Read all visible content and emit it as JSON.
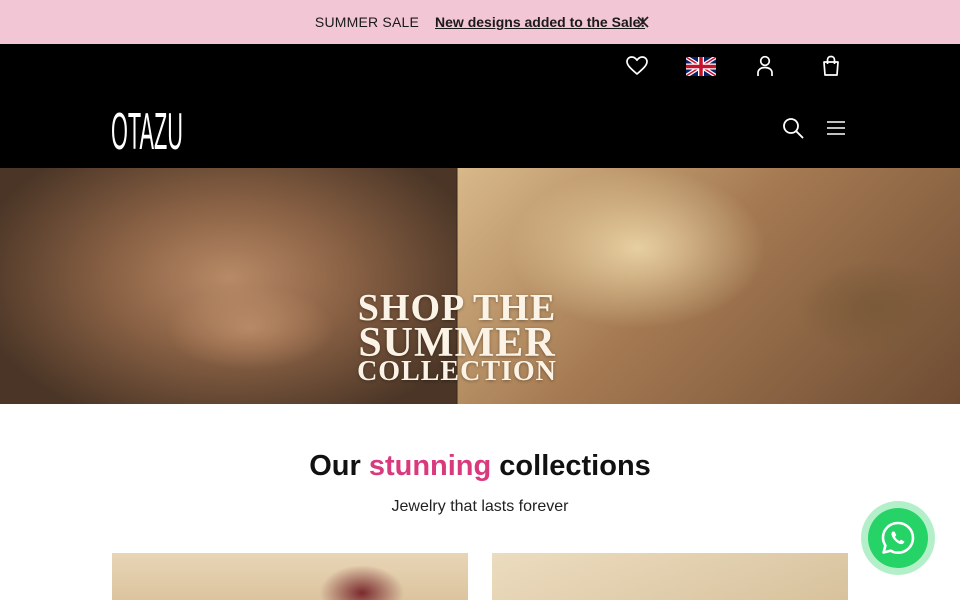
{
  "announcement": {
    "sale_text": "SUMMER SALE",
    "link_text": "New designs added to the Sale!",
    "background": "#f3c6d6"
  },
  "header": {
    "logo_text": "OTAZU",
    "icons": [
      "heart-icon",
      "uk-flag-icon",
      "user-icon",
      "shopping-bag-icon",
      "search-icon",
      "menu-icon"
    ],
    "background": "#000000"
  },
  "hero": {
    "line1": "SHOP THE",
    "line2": "SUMMER",
    "line3": "COLLECTION"
  },
  "collections": {
    "title_prefix": "Our",
    "title_accent": "stunning",
    "title_suffix": "collections",
    "subtitle": "Jewelry that lasts forever",
    "accent_color": "#d93a7e"
  },
  "whatsapp": {
    "icon": "whatsapp-icon",
    "color": "#25d366"
  }
}
